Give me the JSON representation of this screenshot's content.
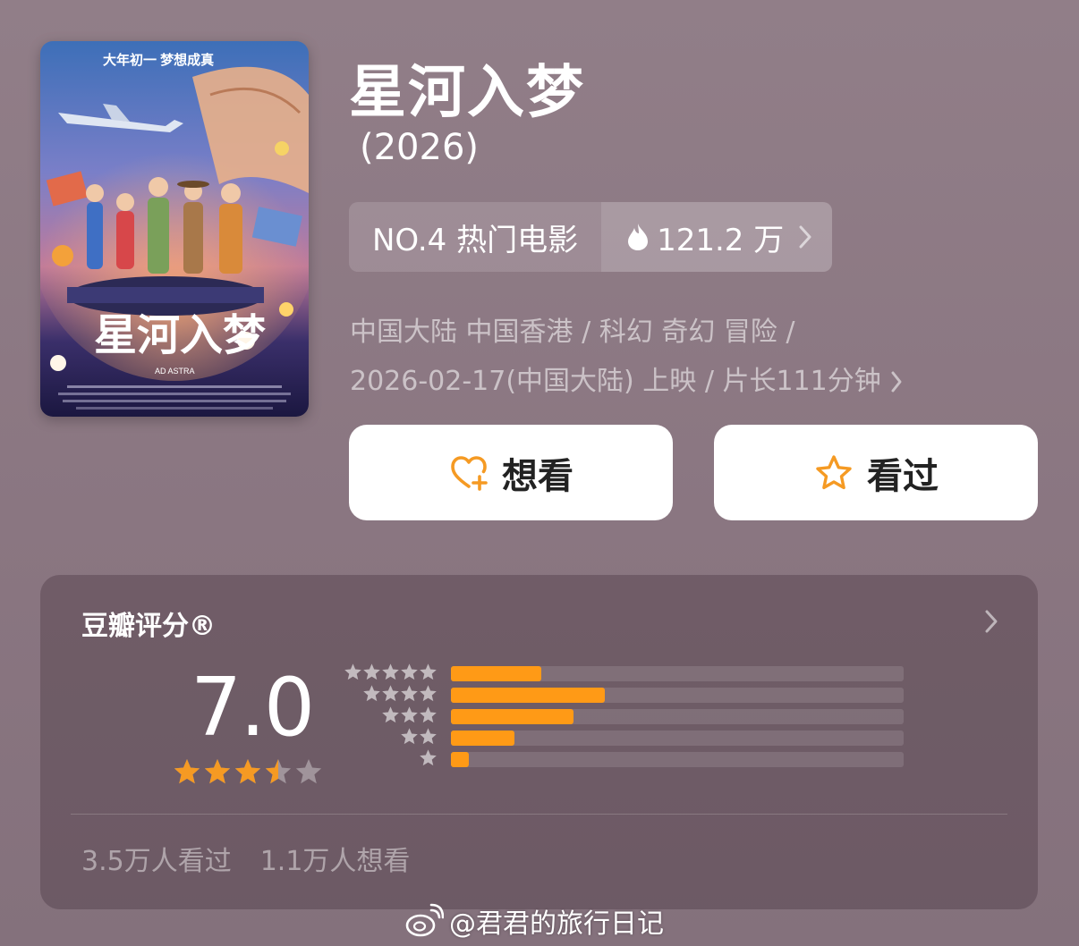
{
  "movie": {
    "title": "星河入梦",
    "year": "(2026)",
    "rank_label": "NO.4 热门电影",
    "heat": "121.2 万",
    "meta_line1": "中国大陆 中国香港 / 科幻 奇幻 冒险 /",
    "meta_line2": "2026-02-17(中国大陆) 上映 / 片长111分钟",
    "poster_title": "星河入梦",
    "poster_tagline": "大年初一 梦想成真",
    "poster_subtitle": "AD ASTRA"
  },
  "actions": {
    "want_label": "想看",
    "seen_label": "看过"
  },
  "rating": {
    "title": "豆瓣评分®",
    "score": "7.0",
    "stars_filled": 3.5,
    "distribution": [
      {
        "stars": 5,
        "fraction": 0.2
      },
      {
        "stars": 4,
        "fraction": 0.34
      },
      {
        "stars": 3,
        "fraction": 0.27
      },
      {
        "stars": 2,
        "fraction": 0.14
      },
      {
        "stars": 1,
        "fraction": 0.04
      }
    ],
    "watched_count": "3.5万人看过",
    "want_count": "1.1万人想看"
  },
  "watermark": {
    "text": "@君君的旅行日记"
  },
  "colors": {
    "accent_orange": "#ff9a16",
    "star_orange": "#f59a23"
  }
}
